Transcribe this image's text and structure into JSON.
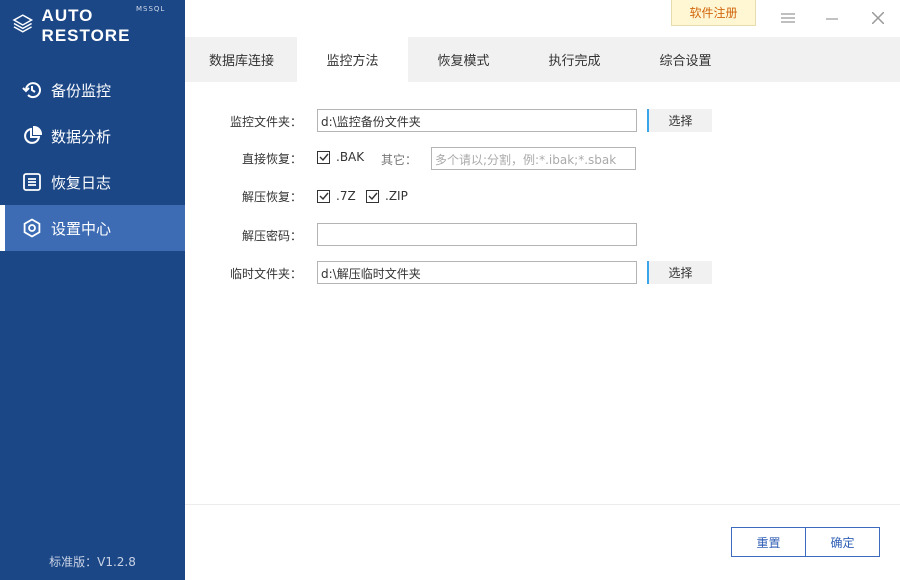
{
  "app": {
    "title": "AUTO RESTORE",
    "subtitle": "MSSQL",
    "version": "标准版：V1.2.8"
  },
  "sidebar": {
    "items": [
      {
        "label": "备份监控",
        "icon": "history-icon"
      },
      {
        "label": "数据分析",
        "icon": "pie-chart-icon"
      },
      {
        "label": "恢复日志",
        "icon": "list-icon"
      },
      {
        "label": "设置中心",
        "icon": "settings-icon",
        "active": true
      }
    ]
  },
  "topbar": {
    "register": "软件注册"
  },
  "tabs": [
    {
      "label": "数据库连接"
    },
    {
      "label": "监控方法",
      "active": true
    },
    {
      "label": "恢复模式"
    },
    {
      "label": "执行完成"
    },
    {
      "label": "综合设置"
    }
  ],
  "form": {
    "watch_folder": {
      "label": "监控文件夹：",
      "value": "d:\\监控备份文件夹",
      "button": "选择"
    },
    "direct_restore": {
      "label": "直接恢复：",
      "bak": ".BAK",
      "bak_checked": true,
      "other_label": "其它：",
      "other_placeholder": "多个请以;分割，例:*.ibak;*.sbak"
    },
    "unzip_restore": {
      "label": "解压恢复：",
      "z7": ".7Z",
      "z7_checked": true,
      "zip": ".ZIP",
      "zip_checked": true
    },
    "unzip_password": {
      "label": "解压密码：",
      "value": ""
    },
    "temp_folder": {
      "label": "临时文件夹：",
      "value": "d:\\解压临时文件夹",
      "button": "选择"
    }
  },
  "footer": {
    "reset": "重置",
    "ok": "确定"
  }
}
